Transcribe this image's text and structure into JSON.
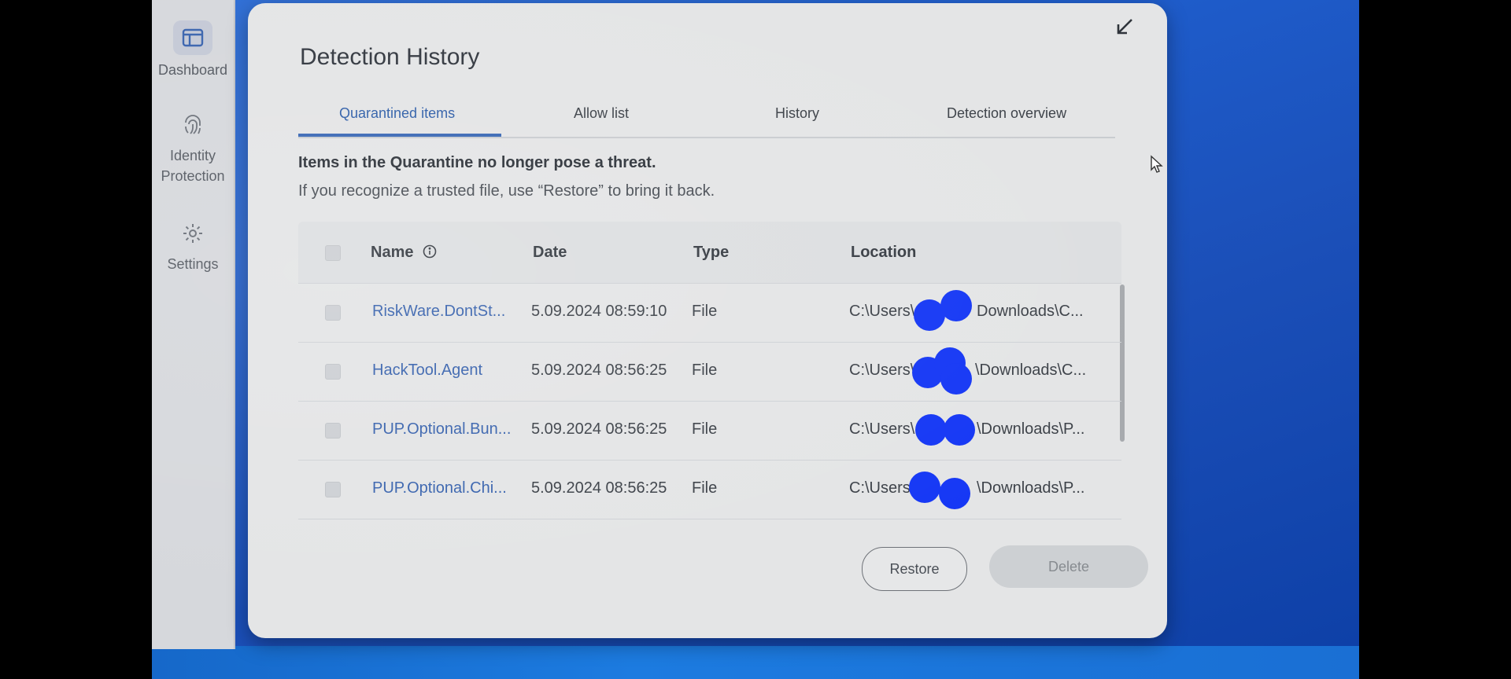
{
  "sidebar": {
    "items": [
      {
        "label": "Dashboard",
        "icon": "dashboard-icon"
      },
      {
        "label": "Identity Protection",
        "label_line1": "Identity",
        "label_line2": "Protection",
        "icon": "fingerprint-icon"
      },
      {
        "label": "Settings",
        "icon": "gear-icon"
      }
    ]
  },
  "dialog": {
    "title": "Detection History",
    "tabs": [
      {
        "label": "Quarantined items",
        "active": true
      },
      {
        "label": "Allow list",
        "active": false
      },
      {
        "label": "History",
        "active": false
      },
      {
        "label": "Detection overview",
        "active": false
      }
    ],
    "intro_bold": "Items in the Quarantine no longer pose a threat.",
    "intro_text": "If you recognize a trusted file, use “Restore” to bring it back.",
    "table": {
      "columns": [
        "Name",
        "Date",
        "Type",
        "Location"
      ],
      "rows": [
        {
          "name": "RiskWare.DontSt...",
          "date": "5.09.2024 08:59:10",
          "type": "File",
          "location_start": "C:\\Users\\a",
          "location_end": "Downloads\\C..."
        },
        {
          "name": "HackTool.Agent",
          "date": "5.09.2024 08:56:25",
          "type": "File",
          "location_start": "C:\\Users\\",
          "location_end": "\\Downloads\\C..."
        },
        {
          "name": "PUP.Optional.Bun...",
          "date": "5.09.2024 08:56:25",
          "type": "File",
          "location_start": "C:\\Users\\",
          "location_end": "\\Downloads\\P..."
        },
        {
          "name": "PUP.Optional.Chi...",
          "date": "5.09.2024 08:56:25",
          "type": "File",
          "location_start": "C:\\Users",
          "location_end": "\\Downloads\\P..."
        }
      ]
    },
    "buttons": {
      "restore": "Restore",
      "delete": "Delete"
    }
  },
  "colors": {
    "accent": "#3a68b5",
    "link": "#3a64ae",
    "redaction": "#1638f5",
    "desktop": "#1e5bc9"
  }
}
